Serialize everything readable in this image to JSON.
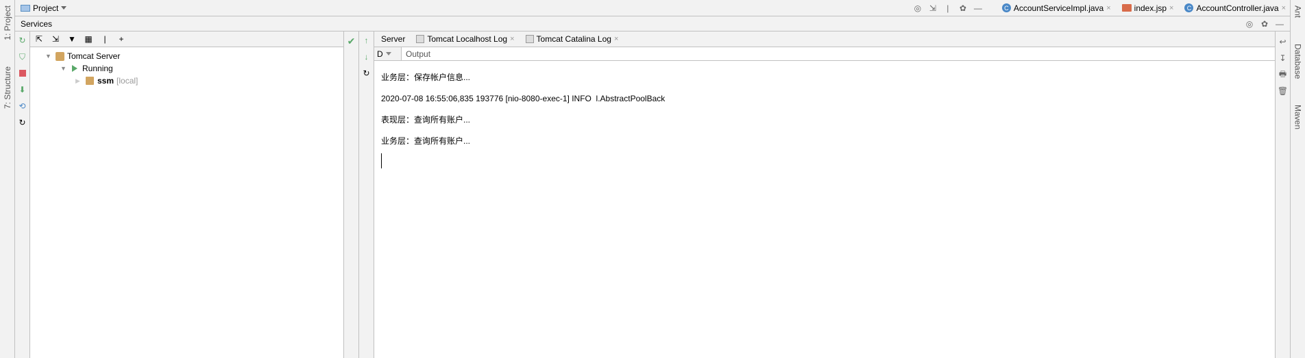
{
  "left_gutter": {
    "project_label": "1: Project",
    "structure_label": "7: Structure"
  },
  "right_gutter": {
    "ant_label": "Ant",
    "database_label": "Database",
    "maven_label": "Maven"
  },
  "top": {
    "project_button": "Project"
  },
  "editor_tabs": [
    {
      "label": "AccountServiceImpl.java",
      "type": "java"
    },
    {
      "label": "index.jsp",
      "type": "jsp"
    },
    {
      "label": "AccountController.java",
      "type": "java"
    }
  ],
  "services": {
    "title": "Services",
    "tree": {
      "root": "Tomcat Server",
      "running": "Running",
      "ssm": "ssm",
      "ssm_suffix": "[local]"
    }
  },
  "console": {
    "tabs": [
      {
        "label": "Server"
      },
      {
        "label": "Tomcat Localhost Log"
      },
      {
        "label": "Tomcat Catalina Log"
      }
    ],
    "d_label": "D",
    "output_label": "Output",
    "lines": [
      "业务层：保存帐户信息...",
      "2020-07-08 16:55:06,835 193776 [nio-8080-exec-1] INFO  l.AbstractPoolBack",
      "表现层：查询所有账户...",
      "业务层：查询所有账户..."
    ]
  }
}
